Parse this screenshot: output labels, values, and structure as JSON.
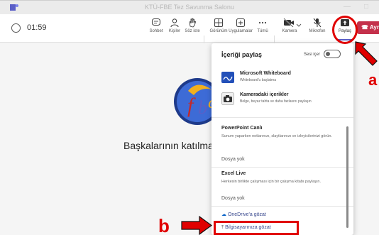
{
  "window": {
    "title": "KTÜ-FBE Tez Savunma Salonu",
    "minimize_glyph": "—",
    "maximize_glyph": "□"
  },
  "toolbar": {
    "timer": "01:59",
    "buttons": {
      "chat": "Sohbet",
      "people": "Kişiler",
      "raise_hand": "Söz iste",
      "view": "Görünüm",
      "apps": "Uygulamalar",
      "more": "Tümü",
      "camera": "Kamera",
      "mic": "Mikrofon",
      "share": "Paylaş",
      "leave": "Ayrıl"
    }
  },
  "main": {
    "participants_text": "Başkalarının katılma"
  },
  "share_panel": {
    "title": "İçeriği paylaş",
    "sound_label": "Sesi içer",
    "options": [
      {
        "title": "Microsoft Whiteboard",
        "subtitle": "Whiteboard'u başlatma"
      },
      {
        "title": "Kameradaki içerikler",
        "subtitle": "Belge, beyaz tahta ve daha fazlasını paylaşın"
      }
    ],
    "powerpoint": {
      "title": "PowerPoint Canlı",
      "desc": "Sunum yaparken notlarınızı, slaytlarınızı ve izleyicilerinizi görün.",
      "empty": "Dosya yok"
    },
    "excel": {
      "title": "Excel Live",
      "desc": "Herkesin birlikte çalışması için bir çalışma kitabı paylaşın.",
      "empty": "Dosya yok"
    },
    "onedrive": "OneDrive'a gözat",
    "browse": "Bilgisayarınıza gözat"
  },
  "annotations": {
    "a": "a",
    "b": "b"
  },
  "colors": {
    "accent": "#5b5fc7",
    "leave": "#c4314b",
    "annotation": "#e00000"
  }
}
